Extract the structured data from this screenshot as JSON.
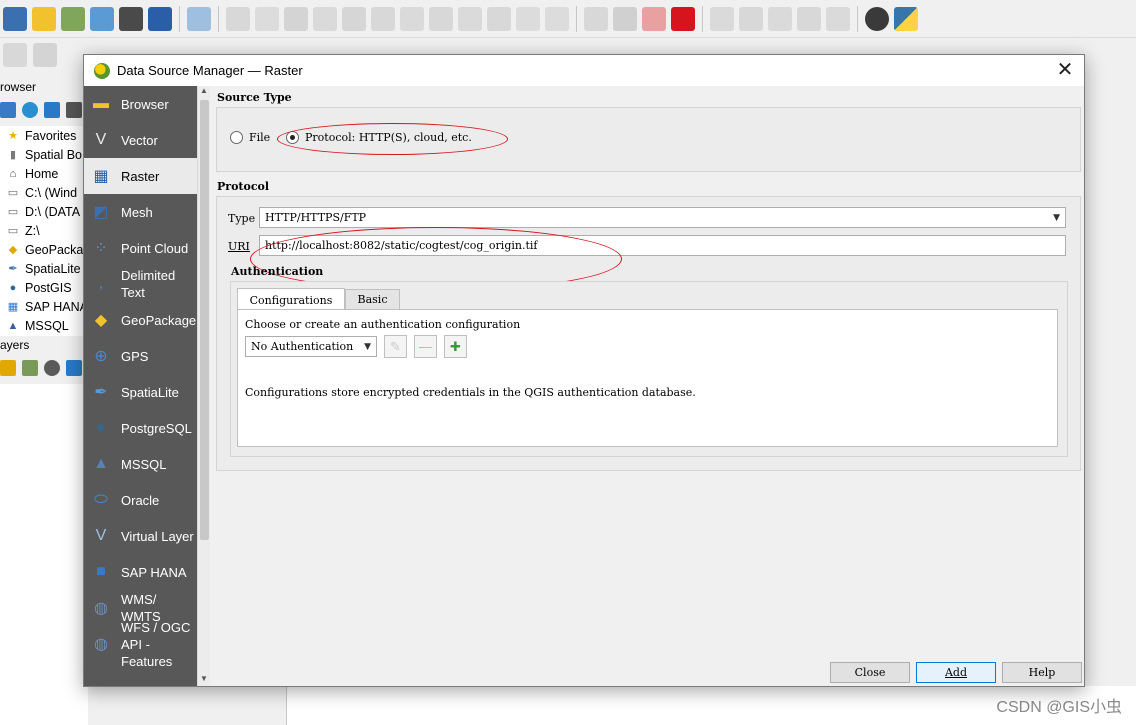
{
  "main_window": {
    "browser_title": "rowser",
    "browser_items": [
      {
        "label": "Favorites",
        "icon": "star-icon",
        "glyph": "★",
        "color": "#e8b400"
      },
      {
        "label": "Spatial Bo",
        "icon": "bookmark-icon",
        "glyph": "▮",
        "color": "#7a7a7a"
      },
      {
        "label": "Home",
        "icon": "home-icon",
        "glyph": "⌂",
        "color": "#444444"
      },
      {
        "label": "C:\\ (Wind",
        "icon": "folder-icon",
        "glyph": "▭",
        "color": "#6a6a6a"
      },
      {
        "label": "D:\\ (DATA",
        "icon": "folder-icon",
        "glyph": "▭",
        "color": "#6a6a6a"
      },
      {
        "label": "Z:\\",
        "icon": "folder-icon",
        "glyph": "▭",
        "color": "#6a6a6a"
      },
      {
        "label": "GeoPacka",
        "icon": "geopackage-icon",
        "glyph": "◆",
        "color": "#e0a800"
      },
      {
        "label": "SpatiaLite",
        "icon": "feather-icon",
        "glyph": "✒",
        "color": "#3a6fa0"
      },
      {
        "label": "PostGIS",
        "icon": "elephant-icon",
        "glyph": "●",
        "color": "#336791"
      },
      {
        "label": "SAP HANA",
        "icon": "grid-icon",
        "glyph": "▦",
        "color": "#2a79c8"
      },
      {
        "label": "MSSQL",
        "icon": "mssql-icon",
        "glyph": "▲",
        "color": "#3a5f9a"
      }
    ],
    "layers_title": "ayers",
    "watermark": "CSDN @GIS小虫"
  },
  "dialog": {
    "title": "Data Source Manager — Raster",
    "close_glyph": "✕",
    "side_items": [
      {
        "label": "Browser",
        "icon": "folder-icon",
        "glyph": "▬",
        "color": "#f2c12e"
      },
      {
        "label": "Vector",
        "icon": "vector-icon",
        "glyph": "V",
        "color": "#e8e8e8"
      },
      {
        "label": "Raster",
        "icon": "raster-icon",
        "glyph": "▦",
        "color": "#2a5ea8"
      },
      {
        "label": "Mesh",
        "icon": "mesh-icon",
        "glyph": "◩",
        "color": "#3a6fb0"
      },
      {
        "label": "Point Cloud",
        "icon": "point-cloud-icon",
        "glyph": "⁘",
        "color": "#5b8fd0"
      },
      {
        "label": "Delimited\nText",
        "icon": "delimited-text-icon",
        "glyph": ",",
        "color": "#4a87d0"
      },
      {
        "label": "GeoPackage",
        "icon": "geopackage-icon",
        "glyph": "◆",
        "color": "#f2c12e"
      },
      {
        "label": "GPS",
        "icon": "gps-icon",
        "glyph": "⊕",
        "color": "#4a87d0"
      },
      {
        "label": "SpatiaLite",
        "icon": "feather-icon",
        "glyph": "✒",
        "color": "#5b9bd5"
      },
      {
        "label": "PostgreSQL",
        "icon": "elephant-icon",
        "glyph": "●",
        "color": "#336791"
      },
      {
        "label": "MSSQL",
        "icon": "mssql-icon",
        "glyph": "▲",
        "color": "#5b7fb8"
      },
      {
        "label": "Oracle",
        "icon": "oracle-icon",
        "glyph": "⬭",
        "color": "#4a87d0"
      },
      {
        "label": "Virtual Layer",
        "icon": "virtual-layer-icon",
        "glyph": "V",
        "color": "#9fbfe0"
      },
      {
        "label": "SAP HANA",
        "icon": "sap-hana-icon",
        "glyph": "■",
        "color": "#3a79c8"
      },
      {
        "label": "WMS/\nWMTS",
        "icon": "globe-icon",
        "glyph": "◍",
        "color": "#6d8fb8"
      },
      {
        "label": "WFS / OGC\nAPI -\nFeatures",
        "icon": "wfs-globe-icon",
        "glyph": "◍",
        "color": "#6d8fb8"
      }
    ],
    "selected_index": 2,
    "source_type": {
      "title": "Source Type",
      "file_label": "File",
      "protocol_label": "Protocol: HTTP(S), cloud, etc.",
      "selected": "protocol"
    },
    "protocol": {
      "title": "Protocol",
      "type_label": "Type",
      "type_value": "HTTP/HTTPS/FTP",
      "uri_label": "URI",
      "uri_value": "http://localhost:8082/static/cogtest/cog_origin.tif"
    },
    "authentication": {
      "title": "Authentication",
      "tabs": [
        "Configurations",
        "Basic"
      ],
      "active_tab": 0,
      "prompt": "Choose or create an authentication configuration",
      "config_value": "No Authentication",
      "info": "Configurations store encrypted credentials in the QGIS authentication database."
    },
    "buttons": {
      "close": "Close",
      "add": "Add",
      "help": "Help"
    }
  },
  "colors": {
    "annotation_red": "#d6141e",
    "side_panel_bg": "#585858",
    "default_button_border": "#0078d7"
  }
}
